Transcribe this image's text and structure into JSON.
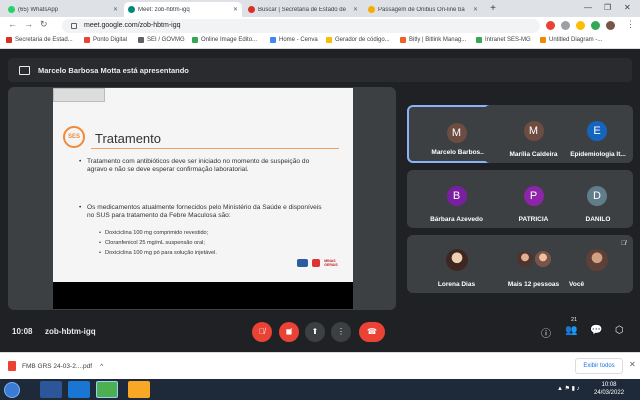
{
  "browser": {
    "tabs": [
      {
        "title": "(65) WhatsApp",
        "color": "#25d366",
        "active": false
      },
      {
        "title": "Meet: zob-hbtm-igq",
        "color": "#00897b",
        "active": true
      },
      {
        "title": "Buscar | Secretaria de Estado de",
        "color": "#d93025",
        "active": false
      },
      {
        "title": "Passagem de Ônibus On-line ba",
        "color": "#f9ab00",
        "active": false
      }
    ],
    "new_tab": "+",
    "url": "meet.google.com/zob-hbtm-igq",
    "bookmarks": [
      {
        "label": "Secretaria de Estad...",
        "color": "#d93025"
      },
      {
        "label": "Ponto Digital",
        "color": "#ea4335"
      },
      {
        "label": "SEI / GOVMG",
        "color": "#5f6368"
      },
      {
        "label": "Online Image Edito...",
        "color": "#34a853"
      },
      {
        "label": "Home - Cenva",
        "color": "#4285f4"
      },
      {
        "label": "Gerador de código...",
        "color": "#fbbc04"
      },
      {
        "label": "Bitly | Bitlink Manag...",
        "color": "#ee6123"
      },
      {
        "label": "Intranet SES-MG",
        "color": "#34a853"
      },
      {
        "label": "Untitled Diagram -...",
        "color": "#f08705"
      }
    ]
  },
  "meet": {
    "presenting_text": "Marcelo Barbosa Motta está apresentando",
    "time": "10:08",
    "meeting_code": "zob-hbtm-igq",
    "participant_count": "21",
    "participants": [
      {
        "name": "Marcelo Barbos...",
        "initial": "M",
        "color": "#6d4c41"
      },
      {
        "name": "Marília Caldeira",
        "initial": "M",
        "color": "#6d4c41"
      },
      {
        "name": "Epidemiologia It...",
        "initial": "E",
        "color": "#1565c0"
      },
      {
        "name": "Bárbara Azevedo",
        "initial": "B",
        "color": "#7b1fa2"
      },
      {
        "name": "PATRICIA",
        "initial": "P",
        "color": "#8e24aa"
      },
      {
        "name": "DANILO",
        "initial": "D",
        "color": "#607d8b"
      },
      {
        "name": "Lorena Dias",
        "initial": "",
        "color": "#8d6e63"
      },
      {
        "name": "Mais 12 pessoas",
        "initial": "",
        "color": "#8d6e63"
      },
      {
        "name": "Você",
        "initial": "",
        "color": "#8d6e63"
      }
    ]
  },
  "slide": {
    "logo_text": "SES",
    "title": "Tratamento",
    "bullet1": "Tratamento com antibióticos deve ser iniciado no momento de suspeição do agravo e não se deve esperar confirmação laboratorial.",
    "bullet2": "Os medicamentos atualmente fornecidos pelo Ministério da Saúde e disponíveis no SUS para tratamento da Febre Maculosa são:",
    "sub1": "Doxiciclina 100 mg comprimido revestido;",
    "sub2": "Cloranfenicol 25 mg/mL suspensão oral;",
    "sub3": "Doxiciclina 100 mg pó para solução injetável.",
    "footer_logo": "MINAS GERAIS"
  },
  "downloads": {
    "file": "FMB GRS 24-03-2....pdf",
    "show_all": "Exibir todos"
  },
  "taskbar": {
    "time": "10:08",
    "date": "24/03/2022"
  }
}
